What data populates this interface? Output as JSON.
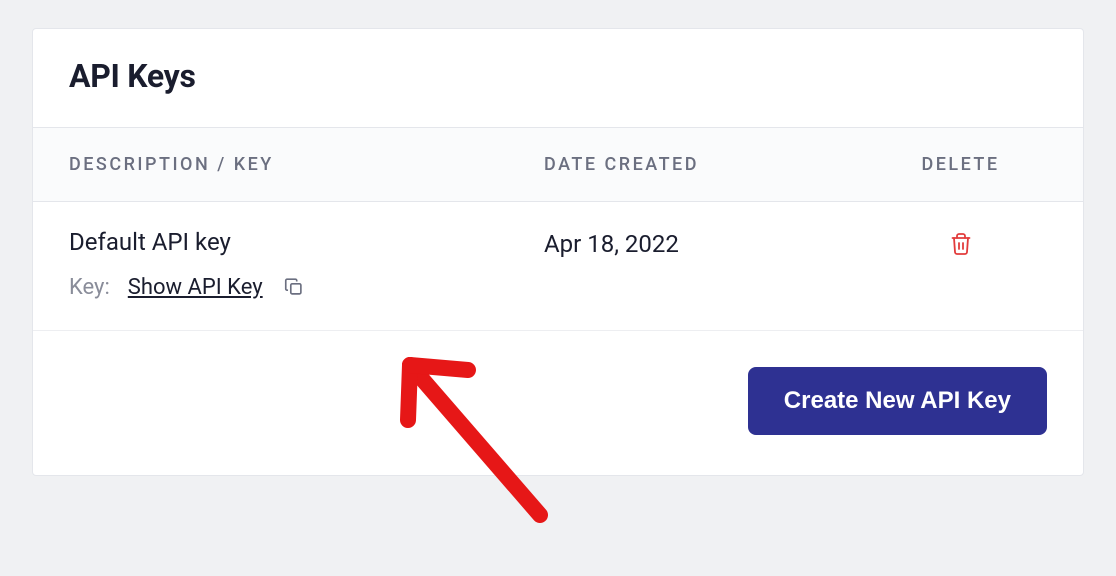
{
  "card": {
    "title": "API Keys"
  },
  "table": {
    "headers": {
      "description": "DESCRIPTION / KEY",
      "date": "DATE CREATED",
      "delete": "DELETE"
    },
    "row": {
      "name": "Default API key",
      "keyLabel": "Key:",
      "showLink": "Show API Key",
      "date": "Apr 18, 2022"
    }
  },
  "footer": {
    "createBtn": "Create New API Key"
  }
}
